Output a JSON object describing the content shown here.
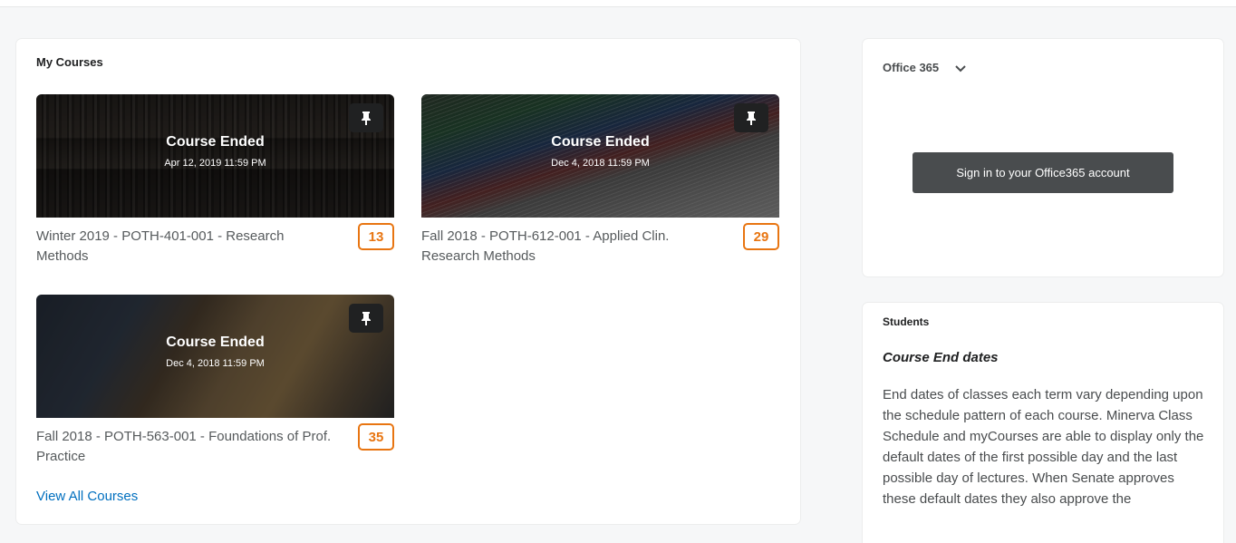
{
  "my_courses": {
    "title": "My Courses",
    "view_all": "View All Courses",
    "cards": [
      {
        "status": "Course Ended",
        "date": "Apr 12, 2019 11:59 PM",
        "name": "Winter 2019 - POTH-401-001 - Research Methods",
        "count": "13"
      },
      {
        "status": "Course Ended",
        "date": "Dec 4, 2018 11:59 PM",
        "name": "Fall 2018 - POTH-612-001 - Applied Clin. Research Methods",
        "count": "29"
      },
      {
        "status": "Course Ended",
        "date": "Dec 4, 2018 11:59 PM",
        "name": "Fall 2018 - POTH-563-001 - Foundations of Prof. Practice",
        "count": "35"
      }
    ]
  },
  "office365": {
    "title": "Office 365",
    "sign_in_label": "Sign in to your Office365 account"
  },
  "students": {
    "title": "Students",
    "heading": "Course End dates",
    "body": "End dates of classes each term vary depending upon the schedule pattern of each course.  Minerva Class Schedule and myCourses are able to display only the default dates of the first possible day and the last possible day of lectures. When Senate approves these default dates they also approve the"
  },
  "colors": {
    "badge": "#e87511",
    "link": "#006fbf",
    "button": "#494c4e"
  },
  "icons": {
    "pin": "pin-icon",
    "chevron": "chevron-down-icon"
  }
}
